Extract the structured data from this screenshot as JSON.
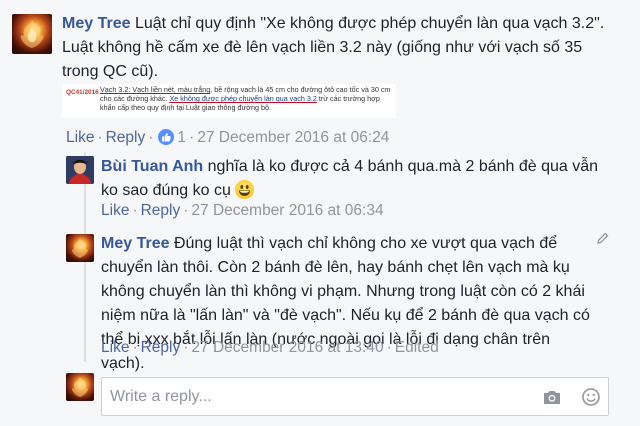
{
  "comments": [
    {
      "author": "Mey Tree",
      "text": "Luật chỉ quy định \"Xe không được phép chuyển làn qua vạch 3.2\". Luật không hề cấm xe đè lên vạch liền 3.2 này (giống như với vạch số 35 trong QC cũ).",
      "attachment": {
        "code": "QC41/2016",
        "text_a": "Vạch 3.2",
        "text_b": ": Vạch liền nét, màu trắng",
        "text_c": ", bề rộng vạch là 45 cm cho đường ôtô cao tốc và 30 cm cho các đường khác. ",
        "text_d": "Xe không được phép chuyển làn qua vạch 3.2",
        "text_e": " trừ các trường hợp khẩn cấp theo quy định tại Luật giao thông đường bộ."
      },
      "like_label": "Like",
      "reply_label": "Reply",
      "reaction_count": "1",
      "timestamp": "27 December 2016 at 06:24"
    },
    {
      "author": "Bùi Tuan Anh",
      "text": "nghĩa là ko được cả 4 bánh qua.mà 2 bánh đè qua vẫn ko sao đúng ko cụ",
      "like_label": "Like",
      "reply_label": "Reply",
      "timestamp": "27 December 2016 at 06:34"
    },
    {
      "author": "Mey Tree",
      "text": "Đúng luật thì vạch chỉ không cho xe vượt qua vạch để chuyển làn thôi. Còn 2 bánh đè lên, hay bánh chẹt lên vạch mà kụ không chuyển làn thì không vi phạm. Nhưng trong luật còn có 2 khái niệm nữa là \"lấn làn\" và \"đè vạch\". Nếu kụ để 2 bánh đè qua vạch có thể bị xxx bắt lỗi lấn làn (nước ngoài gọi là lỗi đi dạng chân trên vạch).",
      "like_label": "Like",
      "reply_label": "Reply",
      "timestamp": "27 December 2016 at 13:40",
      "edited_label": "Edited"
    }
  ],
  "reply_box": {
    "placeholder": "Write a reply..."
  },
  "icons": {
    "like_reaction": "thumbs-up-icon",
    "emoji": "grinning-face-icon",
    "edit": "pencil-icon",
    "camera": "camera-icon",
    "sticker": "smiley-icon"
  },
  "colors": {
    "author": "#365899",
    "action": "#4b67a1",
    "meta": "#90949c",
    "like_badge": "#5890ff",
    "background": "#f6f7f9"
  }
}
